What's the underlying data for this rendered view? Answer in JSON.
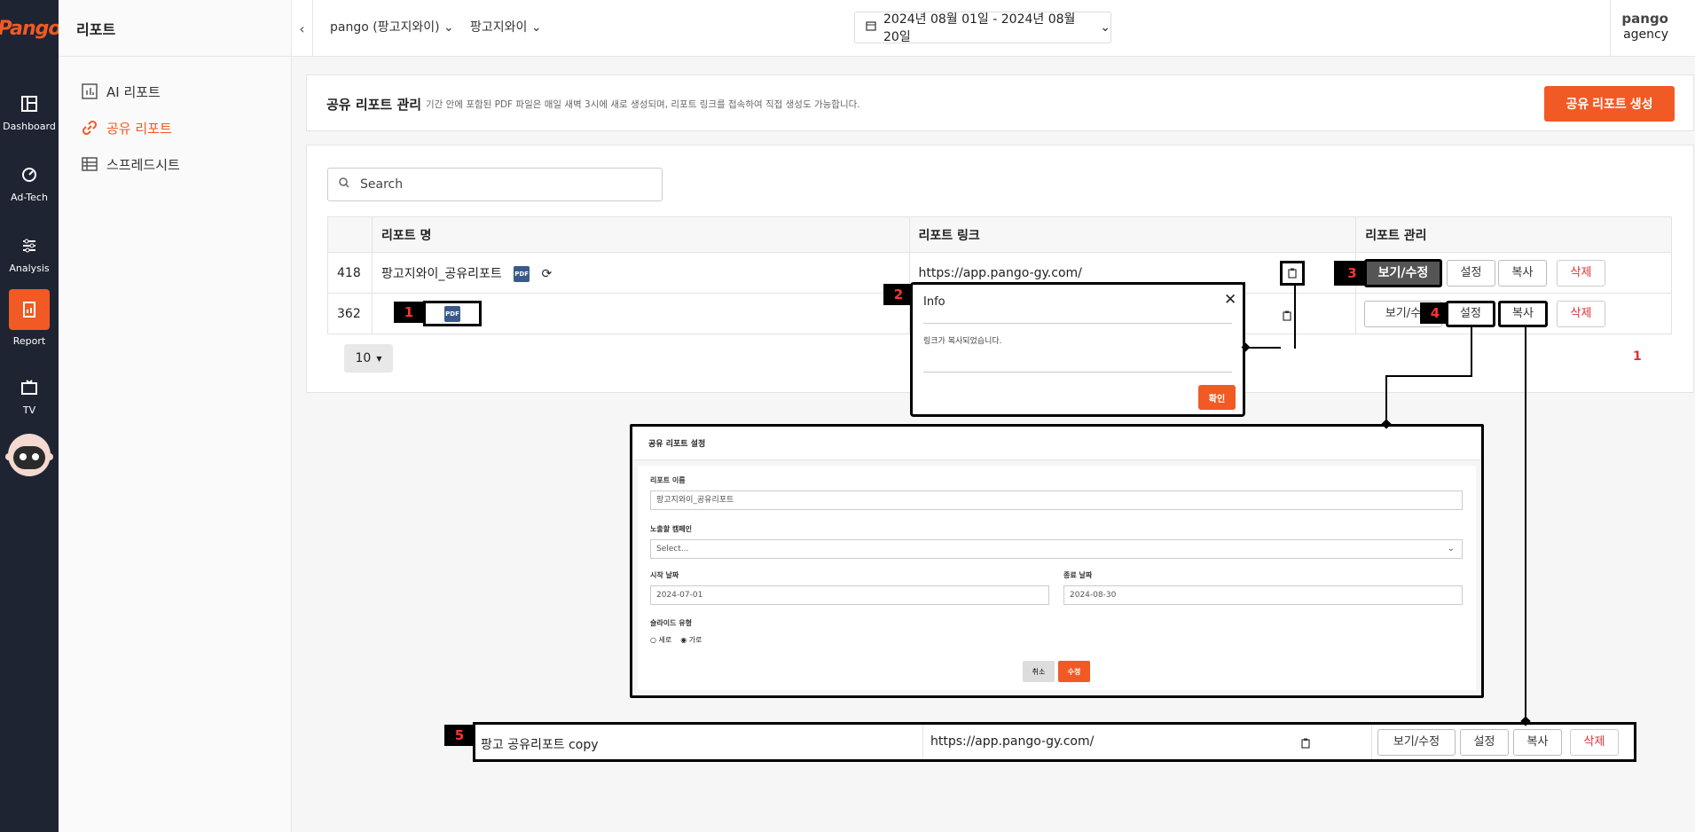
{
  "rail": {
    "logo": "Pango",
    "items": [
      {
        "label": "Dashboard",
        "icon": "dashboard-icon"
      },
      {
        "label": "Ad-Tech",
        "icon": "gauge-icon"
      },
      {
        "label": "Analysis",
        "icon": "sliders-icon"
      },
      {
        "label": "Report",
        "icon": "report-icon"
      },
      {
        "label": "TV",
        "icon": "tv-icon"
      }
    ]
  },
  "subnav": {
    "title": "리포트",
    "items": [
      {
        "label": "AI 리포트",
        "icon": "chart-icon"
      },
      {
        "label": "공유 리포트",
        "icon": "link-icon"
      },
      {
        "label": "스프레드시트",
        "icon": "table-icon"
      }
    ]
  },
  "topbar": {
    "account": "pango (팡고지와이)",
    "brand": "팡고지와이",
    "date_range": "2024년 08월 01일 - 2024년 08월 20일",
    "user_name": "pango",
    "user_role": "agency"
  },
  "header": {
    "title": "공유 리포트 관리",
    "description": "기간 안에 포함된 PDF 파일은 매일 새벽 3시에 새로 생성되며, 리포트 링크를 접속하여 직접 생성도 가능합니다.",
    "create_button": "공유 리포트 생성"
  },
  "search": {
    "placeholder": "Search"
  },
  "table": {
    "columns": [
      "",
      "리포트 명",
      "리포트 링크",
      "리포트 관리"
    ],
    "rows": [
      {
        "id": "418",
        "name": "팡고지와이_공유리포트",
        "link": "https://app.pango-gy.com/"
      },
      {
        "id": "362",
        "name": "",
        "link": ""
      }
    ],
    "actions": {
      "view": "보기/수정",
      "view_short": "보기/수",
      "settings": "설정",
      "copy": "복사",
      "delete": "삭제"
    }
  },
  "page_size": "10",
  "pagination": {
    "current": "1"
  },
  "callouts": [
    "1",
    "2",
    "3",
    "4",
    "5"
  ],
  "info_dialog": {
    "title": "Info",
    "message": "링크가 복사되었습니다.",
    "confirm": "확인"
  },
  "settings_dialog": {
    "title": "공유 리포트 설정",
    "name_label": "리포트 이름",
    "name_value": "팡고지와이_공유리포트",
    "campaign_label": "노출할 캠페인",
    "campaign_placeholder": "Select...",
    "start_label": "시작 날짜",
    "start_value": "2024-07-01",
    "end_label": "종료 날짜",
    "end_value": "2024-08-30",
    "slide_label": "슬라이드 유형",
    "slide_options": [
      "세로",
      "가로"
    ],
    "cancel": "취소",
    "submit": "수정"
  },
  "copied_row": {
    "name": "팡고 공유리포트 copy",
    "link": "https://app.pango-gy.com/"
  },
  "colors": {
    "accent": "#f15a24",
    "rail": "#1f2433"
  }
}
